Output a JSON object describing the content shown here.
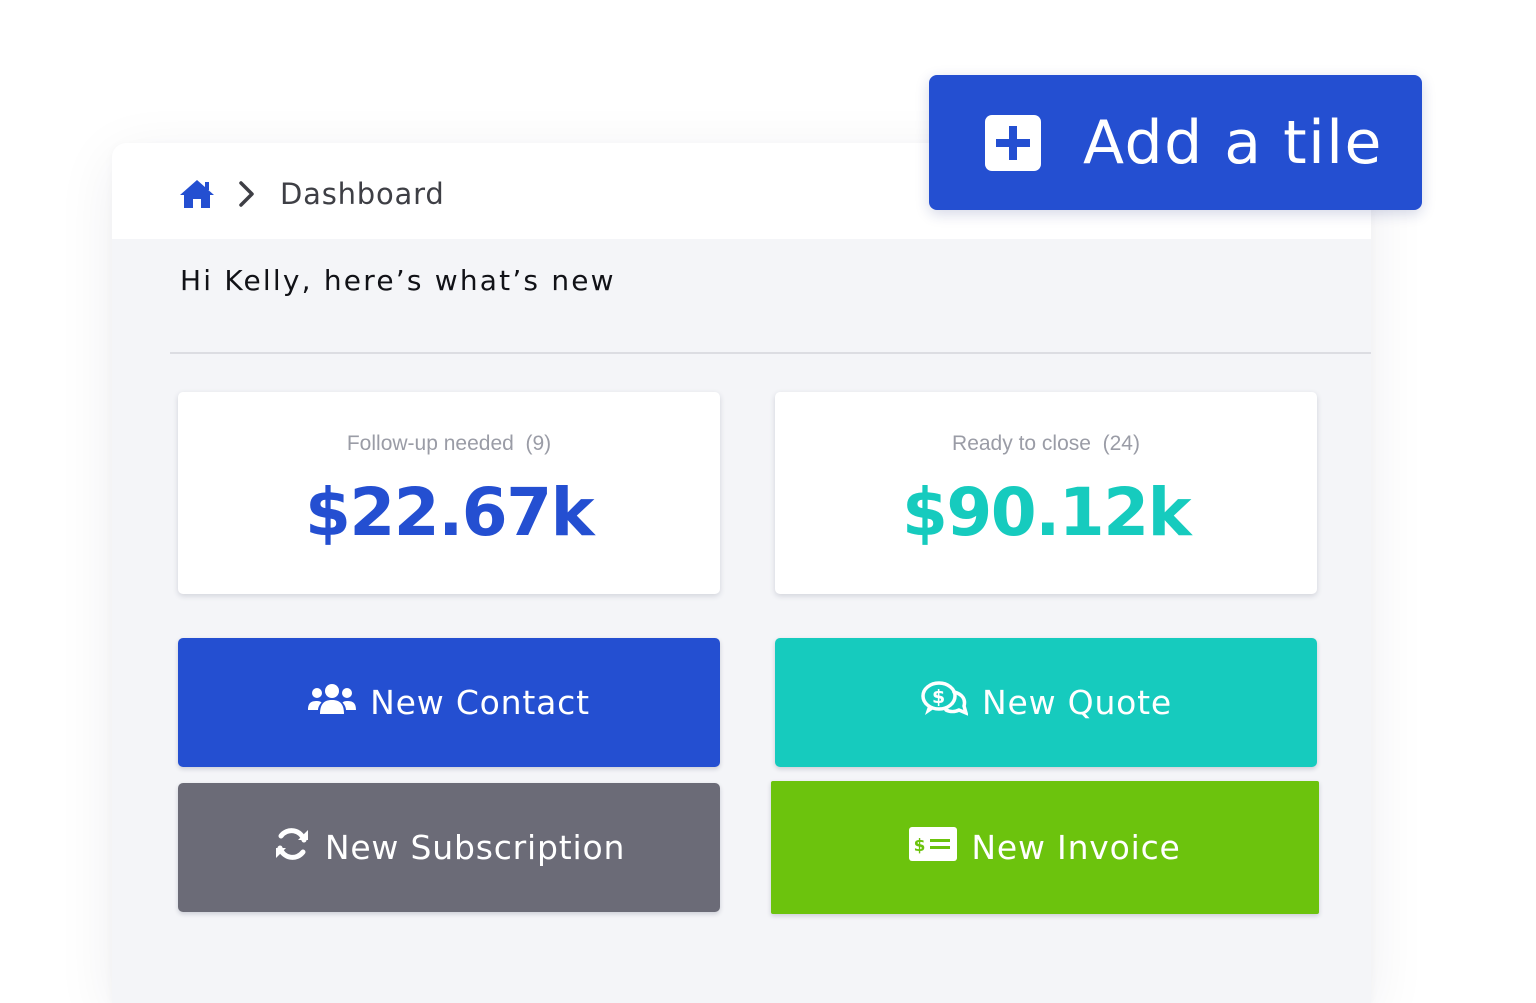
{
  "breadcrumb": {
    "home_icon": "home-icon",
    "separator_icon": "chevron-right-icon",
    "current": "Dashboard"
  },
  "greeting": "Hi Kelly, here’s what’s new",
  "stats": [
    {
      "label": "Follow-up needed  (9)",
      "value": "$22.67k",
      "color": "#244fd1"
    },
    {
      "label": "Ready to close  (24)",
      "value": "$90.12k",
      "color": "#16cbbe"
    }
  ],
  "actions": {
    "new_contact": {
      "label": "New Contact",
      "icon": "users-icon",
      "color": "#244fd1"
    },
    "new_quote": {
      "label": "New Quote",
      "icon": "dollar-chat-icon",
      "color": "#16cbbe"
    },
    "new_subscription": {
      "label": "New Subscription",
      "icon": "refresh-icon",
      "color": "#6b6b77"
    },
    "new_invoice": {
      "label": "New Invoice",
      "icon": "invoice-icon",
      "color": "#6cc30d"
    }
  },
  "add_tile": {
    "label": "Add a tile",
    "icon": "plus-square-icon",
    "color": "#244fd1"
  }
}
